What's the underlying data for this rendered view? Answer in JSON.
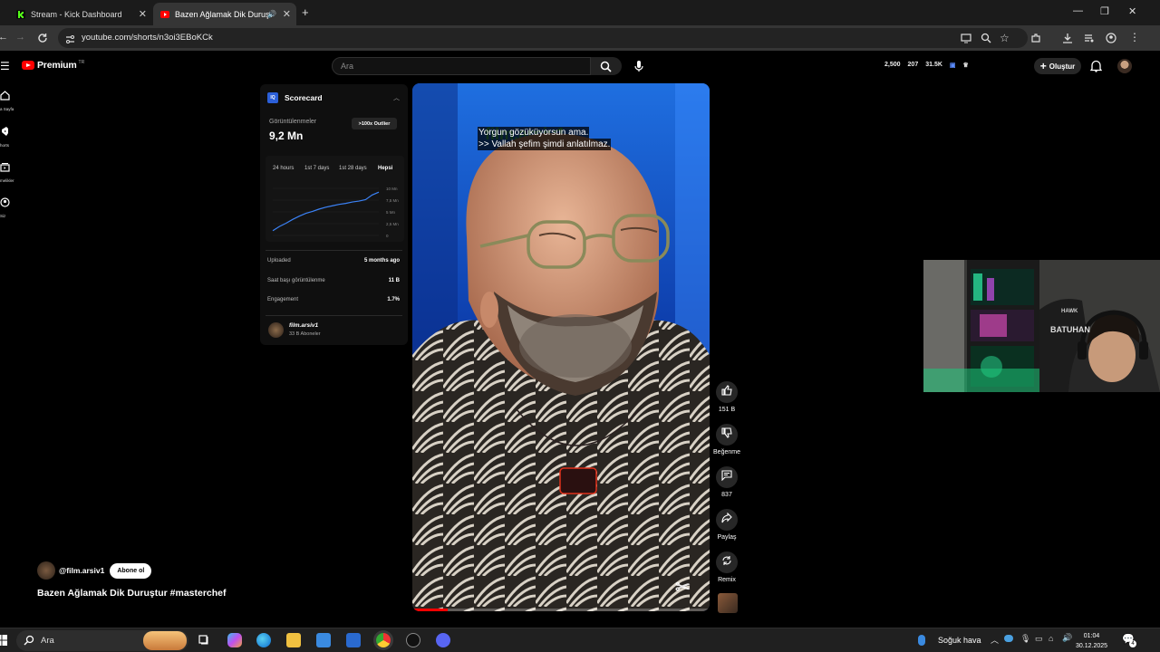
{
  "browser": {
    "tabs": [
      {
        "label": "Stream - Kick Dashboard",
        "active": false
      },
      {
        "label": "Bazen Ağlamak Dik Duruşt",
        "active": true
      }
    ],
    "url": "youtube.com/shorts/n3oi3EBoKCk"
  },
  "youtube": {
    "logo_text": "Premium",
    "logo_sup": "TR",
    "search_placeholder": "Ara",
    "create_label": "Oluştur",
    "header_stats": [
      "2,500",
      "207",
      "31.5K"
    ],
    "left_nav": [
      "a Sayfa",
      "horts",
      "melikler",
      "Siz"
    ]
  },
  "scorecard": {
    "logo": "IQ",
    "title": "Scorecard",
    "views_label": "Görüntülenmeler",
    "views_value": "9,2 Mn",
    "outlier_label": ">100x Outlier",
    "range_tabs": [
      "24 hours",
      "1st 7 days",
      "1st 28 days",
      "Hepsi"
    ],
    "selected_range": "Hepsi",
    "metrics": [
      {
        "label": "Uploaded",
        "value": "5 months ago"
      },
      {
        "label": "Saat başı görüntülenme",
        "value": "11 B"
      },
      {
        "label": "Engagement",
        "value": "1.7%"
      }
    ],
    "channel_name": "film.arsiv1",
    "channel_subs": "33 B Aboneler"
  },
  "chart_data": {
    "type": "line",
    "y_ticks": [
      "10 Mn",
      "7,5 Mn",
      "5 Mn",
      "2,5 Mn",
      "0"
    ],
    "ylim": [
      0,
      10
    ],
    "x": [
      0,
      1,
      2,
      3,
      4,
      5,
      6,
      7,
      8,
      9,
      10,
      11,
      12,
      13,
      14,
      15,
      16
    ],
    "values": [
      1.0,
      1.9,
      2.6,
      3.4,
      4.1,
      4.7,
      5.1,
      5.6,
      6.0,
      6.3,
      6.6,
      6.8,
      7.1,
      7.3,
      7.6,
      8.6,
      9.2
    ]
  },
  "video": {
    "subtitle_lines": [
      "Yorgun gözüküyorsun ama.",
      ">> Vallah şefim şimdi anlatılmaz."
    ],
    "progress": 0.12,
    "actions": [
      {
        "icon": "thumbs-up-icon",
        "label": "151 B"
      },
      {
        "icon": "thumbs-down-icon",
        "label": "Beğenme"
      },
      {
        "icon": "comment-icon",
        "label": "837"
      },
      {
        "icon": "share-icon",
        "label": "Paylaş"
      },
      {
        "icon": "remix-icon",
        "label": "Remix"
      }
    ],
    "channel_handle": "@film.arsiv1",
    "subscribe_label": "Abone ol",
    "title": "Bazen Ağlamak Dik Duruştur #masterchef"
  },
  "taskbar": {
    "search_placeholder": "Ara",
    "weather": "Soğuk hava",
    "time": "01:04",
    "date": "30.12.2025",
    "notification_count": "4"
  },
  "colors": {
    "accent_red": "#ff0000",
    "kick_green": "#53fc18",
    "scorecard_blue": "#2b5fd8",
    "chart_line": "#3b82f6"
  }
}
